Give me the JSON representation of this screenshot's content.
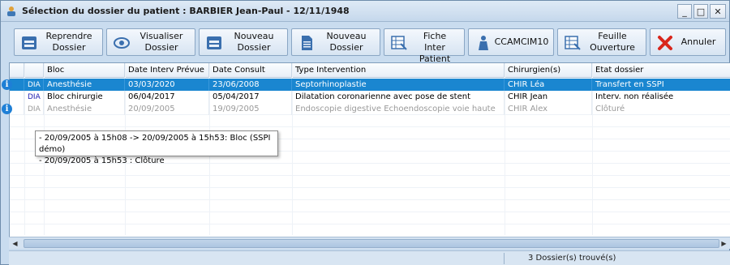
{
  "window": {
    "title": "Sélection du dossier du patient : BARBIER Jean-Paul - 12/11/1948",
    "minimize": "_",
    "maximize": "□",
    "close": "✕"
  },
  "toolbar": {
    "buttons": [
      {
        "label": "Reprendre\nDossier",
        "icon": "folder-resume-icon"
      },
      {
        "label": "Visualiser\nDossier",
        "icon": "eye-icon"
      },
      {
        "label": "Nouveau\nDossier",
        "icon": "new-folder-icon"
      },
      {
        "label": "Nouveau\nDossier",
        "icon": "new-document-icon"
      },
      {
        "label": "Fiche\nInter Patient",
        "icon": "sheet-icon"
      },
      {
        "label": "CCAMCIM10",
        "icon": "person-icon"
      },
      {
        "label": "Feuille\nOuverture",
        "icon": "sheet-open-icon"
      },
      {
        "label": "Annuler",
        "icon": "cancel-icon"
      }
    ]
  },
  "grid": {
    "columns": [
      "",
      "",
      "Bloc",
      "Date Interv Prévue",
      "Date Consult",
      "Type Intervention",
      "Chirurgien(s)",
      "Etat dossier"
    ],
    "rows": [
      {
        "info": true,
        "tag": "DIA",
        "bloc": "Anesthésie",
        "date_interv": "03/03/2020",
        "date_consult": "23/06/2008",
        "type": "Septorhinoplastie",
        "chirurgien": "CHIR Léa",
        "etat": "Transfert en SSPI",
        "state": "selected"
      },
      {
        "info": false,
        "tag": "DIA",
        "bloc": "Bloc chirurgie",
        "date_interv": "06/04/2017",
        "date_consult": "05/04/2017",
        "type": "Dilatation coronarienne avec pose de stent",
        "chirurgien": "CHIR Jean",
        "etat": "Interv. non réalisée",
        "state": "normal"
      },
      {
        "info": true,
        "tag": "DIA",
        "bloc": "Anesthésie",
        "date_interv": "20/09/2005",
        "date_consult": "19/09/2005",
        "type": "Endoscopie digestive Echoendoscopie voie haute",
        "chirurgien": "CHIR Alex",
        "etat": "Clôturé",
        "state": "grey"
      }
    ]
  },
  "tooltip": {
    "line1": "- 20/09/2005 à 15h08 -> 20/09/2005 à 15h53: Bloc (SSPI démo)",
    "line2": "- 20/09/2005 à 15h53 : Clôture"
  },
  "status": {
    "count": "3 Dossier(s) trouvé(s)"
  },
  "colors": {
    "selection": "#1a86d0",
    "window_bg": "#c9dcef",
    "cancel_red": "#d9261c"
  }
}
